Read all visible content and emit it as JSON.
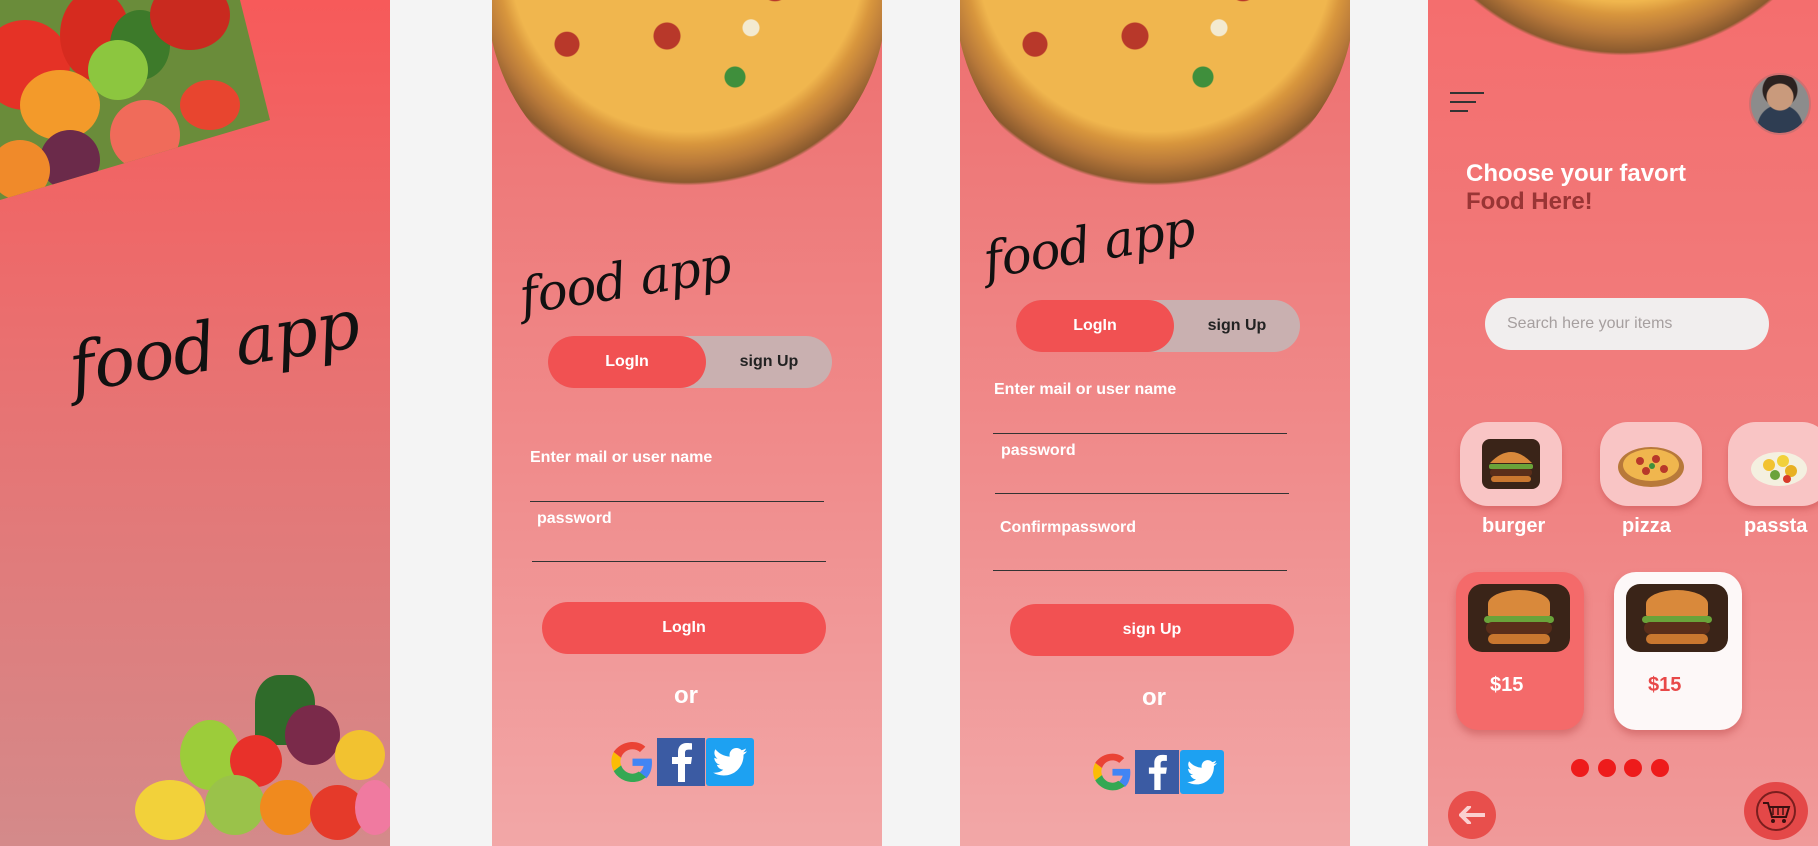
{
  "brand": {
    "logo": "food app"
  },
  "auth": {
    "toggle_login": "LogIn",
    "toggle_signup": "sign Up",
    "field_email": "Enter mail or user name",
    "field_password": "password",
    "field_confirm": "Confirmpassword",
    "login_button": "LogIn",
    "signup_button": "sign Up",
    "or": "or",
    "social": [
      "google",
      "facebook",
      "twitter"
    ]
  },
  "home": {
    "heading_line1": "Choose your favort",
    "heading_line2": "Food Here!",
    "search_placeholder": "Search here your items",
    "categories": [
      {
        "label": "burger",
        "icon": "burger-icon"
      },
      {
        "label": "pizza",
        "icon": "pizza-icon"
      },
      {
        "label": "passta",
        "icon": "pasta-icon"
      }
    ],
    "cards": [
      {
        "price": "$15",
        "style": "active"
      },
      {
        "price": "$15",
        "style": "default"
      }
    ],
    "pagination_dots": 4
  },
  "colors": {
    "accent": "#f25152",
    "dot": "#ee1b1b",
    "toggle_track": "#c9b0b0",
    "search_bg": "#f1eeee"
  }
}
